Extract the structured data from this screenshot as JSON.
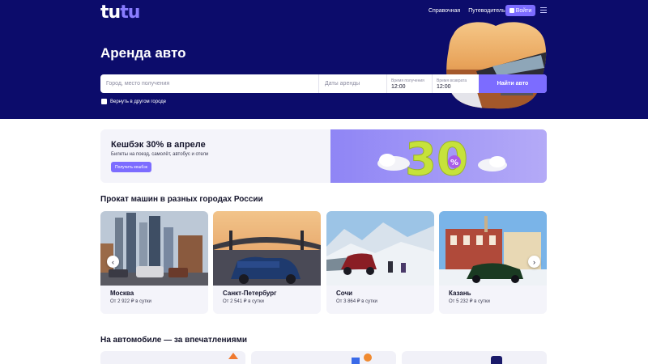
{
  "header": {
    "logo_main": "tu",
    "logo_accent": "tu",
    "nav": [
      "Справочная",
      "Путеводитель"
    ],
    "login_label": "Войти"
  },
  "hero": {
    "title": "Аренда авто",
    "search": {
      "place_placeholder": "Город, место получения",
      "dates_placeholder": "Даты аренды",
      "pickup_label": "Время получения",
      "pickup_time": "12:00",
      "return_label": "Время возврата",
      "return_time": "12:00",
      "find_button": "Найти авто"
    },
    "return_other_city": "Вернуть в другом городе"
  },
  "promo": {
    "title": "Кешбэк 30% в апреле",
    "subtitle": "Билеты на поезд, самолёт, автобус и отели",
    "button": "Получить кешбэк",
    "art_number": "30",
    "art_symbol": "%"
  },
  "cities_section": {
    "title": "Прокат машин в разных городах России",
    "cities": [
      {
        "name": "Москва",
        "price": "От 2 922 ₽ в сутки"
      },
      {
        "name": "Санкт-Петербург",
        "price": "От 2 541 ₽ в сутки"
      },
      {
        "name": "Сочи",
        "price": "От 3 864 ₽ в сутки"
      },
      {
        "name": "Казань",
        "price": "От 5 232 ₽ в сутки"
      }
    ]
  },
  "experiences_section": {
    "title": "На автомобиле — за впечатлениями"
  },
  "colors": {
    "hero_bg": "#0c0c6b",
    "accent": "#7c6cff",
    "card_bg": "#f4f4fa"
  }
}
